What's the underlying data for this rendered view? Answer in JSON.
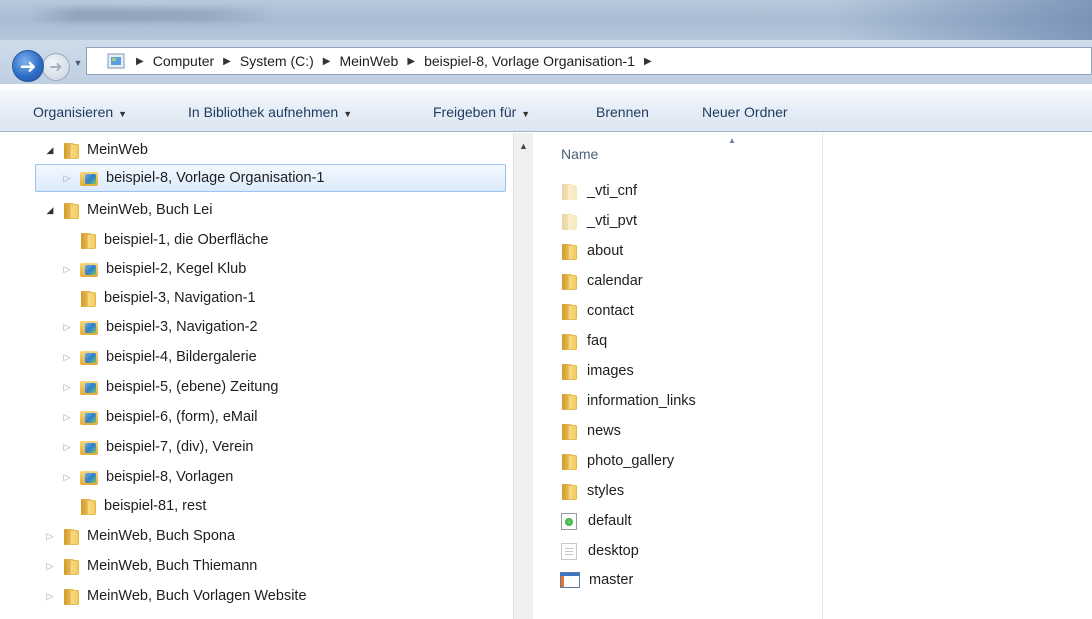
{
  "address": {
    "segments": [
      "Computer",
      "System (C:)",
      "MeinWeb",
      "beispiel-8, Vorlage Organisation-1"
    ]
  },
  "toolbar": {
    "organize": "Organisieren",
    "library": "In Bibliothek aufnehmen",
    "share": "Freigeben für",
    "burn": "Brennen",
    "new_folder": "Neuer Ordner"
  },
  "tree": {
    "items": [
      {
        "label": "MeinWeb",
        "state": "expanded",
        "icon": "folder-icon"
      },
      {
        "label": "beispiel-8, Vorlage Organisation-1",
        "state": "collapsed",
        "icon": "web-folder-icon",
        "selected": true
      },
      {
        "label": "MeinWeb, Buch Lei",
        "state": "expanded",
        "icon": "folder-icon"
      },
      {
        "label": "beispiel-1, die Oberfläche",
        "state": "leaf",
        "icon": "folder-icon"
      },
      {
        "label": "beispiel-2, Kegel Klub",
        "state": "collapsed",
        "icon": "web-folder-icon"
      },
      {
        "label": "beispiel-3, Navigation-1",
        "state": "leaf",
        "icon": "folder-icon"
      },
      {
        "label": "beispiel-3, Navigation-2",
        "state": "collapsed",
        "icon": "web-folder-icon"
      },
      {
        "label": "beispiel-4, Bildergalerie",
        "state": "collapsed",
        "icon": "web-folder-icon"
      },
      {
        "label": "beispiel-5, (ebene) Zeitung",
        "state": "collapsed",
        "icon": "web-folder-icon"
      },
      {
        "label": "beispiel-6, (form), eMail",
        "state": "collapsed",
        "icon": "web-folder-icon"
      },
      {
        "label": "beispiel-7, (div), Verein",
        "state": "collapsed",
        "icon": "web-folder-icon"
      },
      {
        "label": "beispiel-8, Vorlagen",
        "state": "collapsed",
        "icon": "web-folder-icon"
      },
      {
        "label": "beispiel-81, rest",
        "state": "leaf",
        "icon": "folder-icon"
      },
      {
        "label": "MeinWeb, Buch Spona",
        "state": "collapsed",
        "icon": "folder-icon"
      },
      {
        "label": "MeinWeb, Buch Thiemann",
        "state": "collapsed",
        "icon": "folder-icon"
      },
      {
        "label": "MeinWeb, Buch Vorlagen Website",
        "state": "collapsed",
        "icon": "folder-icon"
      }
    ]
  },
  "files": {
    "column_header": "Name",
    "items": [
      {
        "name": "_vti_cnf",
        "icon": "hidden-folder-icon"
      },
      {
        "name": "_vti_pvt",
        "icon": "hidden-folder-icon"
      },
      {
        "name": "about",
        "icon": "folder-icon"
      },
      {
        "name": "calendar",
        "icon": "folder-icon"
      },
      {
        "name": "contact",
        "icon": "folder-icon"
      },
      {
        "name": "faq",
        "icon": "folder-icon"
      },
      {
        "name": "images",
        "icon": "folder-icon"
      },
      {
        "name": "information_links",
        "icon": "folder-icon"
      },
      {
        "name": "news",
        "icon": "folder-icon"
      },
      {
        "name": "photo_gallery",
        "icon": "folder-icon"
      },
      {
        "name": "styles",
        "icon": "folder-icon"
      },
      {
        "name": "default",
        "icon": "html-file-icon"
      },
      {
        "name": "desktop",
        "icon": "ini-file-icon"
      },
      {
        "name": "master",
        "icon": "master-page-icon"
      }
    ]
  }
}
